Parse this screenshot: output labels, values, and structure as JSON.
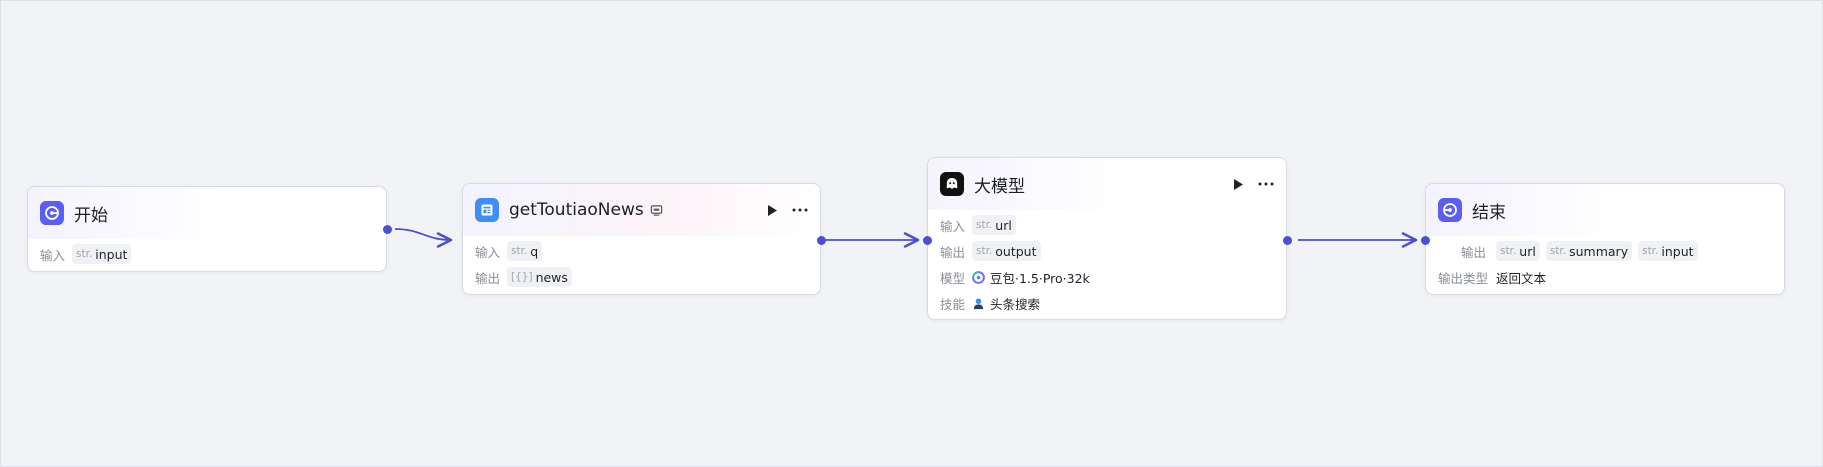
{
  "colors": {
    "accent": "#5b5ef2",
    "edge": "#4d4fd1",
    "plugin_icon": "#3d8ff7",
    "llm_icon": "#111111"
  },
  "nodes": {
    "start": {
      "title": "开始",
      "icon": "start-icon",
      "input_label": "输入",
      "inputs": [
        {
          "type": "str.",
          "name": "input"
        }
      ]
    },
    "plugin": {
      "title": "getToutiaoNews",
      "icon": "newspaper-icon",
      "badge_icon": "plugin-badge-icon",
      "input_label": "输入",
      "output_label": "输出",
      "inputs": [
        {
          "type": "str.",
          "name": "q"
        }
      ],
      "outputs": [
        {
          "type": "[{}]",
          "name": "news"
        }
      ]
    },
    "llm": {
      "title": "大模型",
      "icon": "llm-robot-icon",
      "input_label": "输入",
      "output_label": "输出",
      "model_label": "模型",
      "skill_label": "技能",
      "inputs": [
        {
          "type": "str.",
          "name": "url"
        }
      ],
      "outputs": [
        {
          "type": "str.",
          "name": "output"
        }
      ],
      "model": "豆包·1.5·Pro·32k",
      "skill": "头条搜索"
    },
    "end": {
      "title": "结束",
      "icon": "end-icon",
      "output_label": "输出",
      "output_type_label": "输出类型",
      "outputs": [
        {
          "type": "str.",
          "name": "url"
        },
        {
          "type": "str.",
          "name": "summary"
        },
        {
          "type": "str.",
          "name": "input"
        }
      ],
      "output_type": "返回文本"
    }
  }
}
